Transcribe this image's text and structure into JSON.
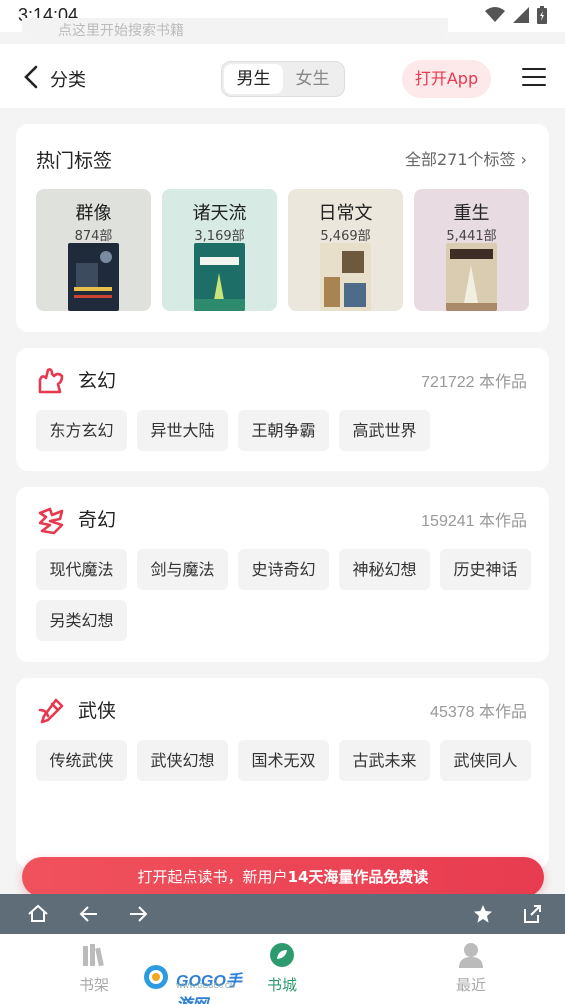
{
  "status_bar": {
    "time": "3:14:04"
  },
  "search": {
    "placeholder": "点这里开始搜索书籍"
  },
  "nav": {
    "back_label": "分类",
    "gender_options": [
      "男生",
      "女生"
    ],
    "gender_selected": "男生",
    "open_app_label": "打开App"
  },
  "hot_tags": {
    "title": "热门标签",
    "all_label": "全部271个标签",
    "items": [
      {
        "name": "群像",
        "count": "874部",
        "bg": "#dfe1dc"
      },
      {
        "name": "诸天流",
        "count": "3,169部",
        "bg": "#d7eae4"
      },
      {
        "name": "日常文",
        "count": "5,469部",
        "bg": "#ece7dc"
      },
      {
        "name": "重生",
        "count": "5,441部",
        "bg": "#e8dce2"
      }
    ]
  },
  "categories": [
    {
      "name": "玄幻",
      "count": "721722 本作品",
      "icon": "xuanhuan-icon",
      "subs": [
        "东方玄幻",
        "异世大陆",
        "王朝争霸",
        "高武世界"
      ]
    },
    {
      "name": "奇幻",
      "count": "159241 本作品",
      "icon": "qihuan-icon",
      "subs": [
        "现代魔法",
        "剑与魔法",
        "史诗奇幻",
        "神秘幻想",
        "历史神话",
        "另类幻想"
      ]
    },
    {
      "name": "武侠",
      "count": "45378 本作品",
      "icon": "wuxia-icon",
      "subs": [
        "传统武侠",
        "武侠幻想",
        "国术无双",
        "古武未来",
        "武侠同人"
      ]
    }
  ],
  "banner": {
    "prefix": "打开起点读书，新用户",
    "highlight": "14天海量作品免费读"
  },
  "tabs": [
    {
      "label": "书架",
      "icon": "bookshelf-icon"
    },
    {
      "label": "书城",
      "icon": "bookstore-icon"
    },
    {
      "label": "最近",
      "icon": "profile-icon"
    }
  ],
  "watermark": {
    "brand": "GOGO手游网",
    "url": "WWW.GOGO8.CN"
  },
  "colors": {
    "accent": "#e6394f",
    "tab_active": "#2e9b6f",
    "browser_bar": "#5f6d78"
  }
}
